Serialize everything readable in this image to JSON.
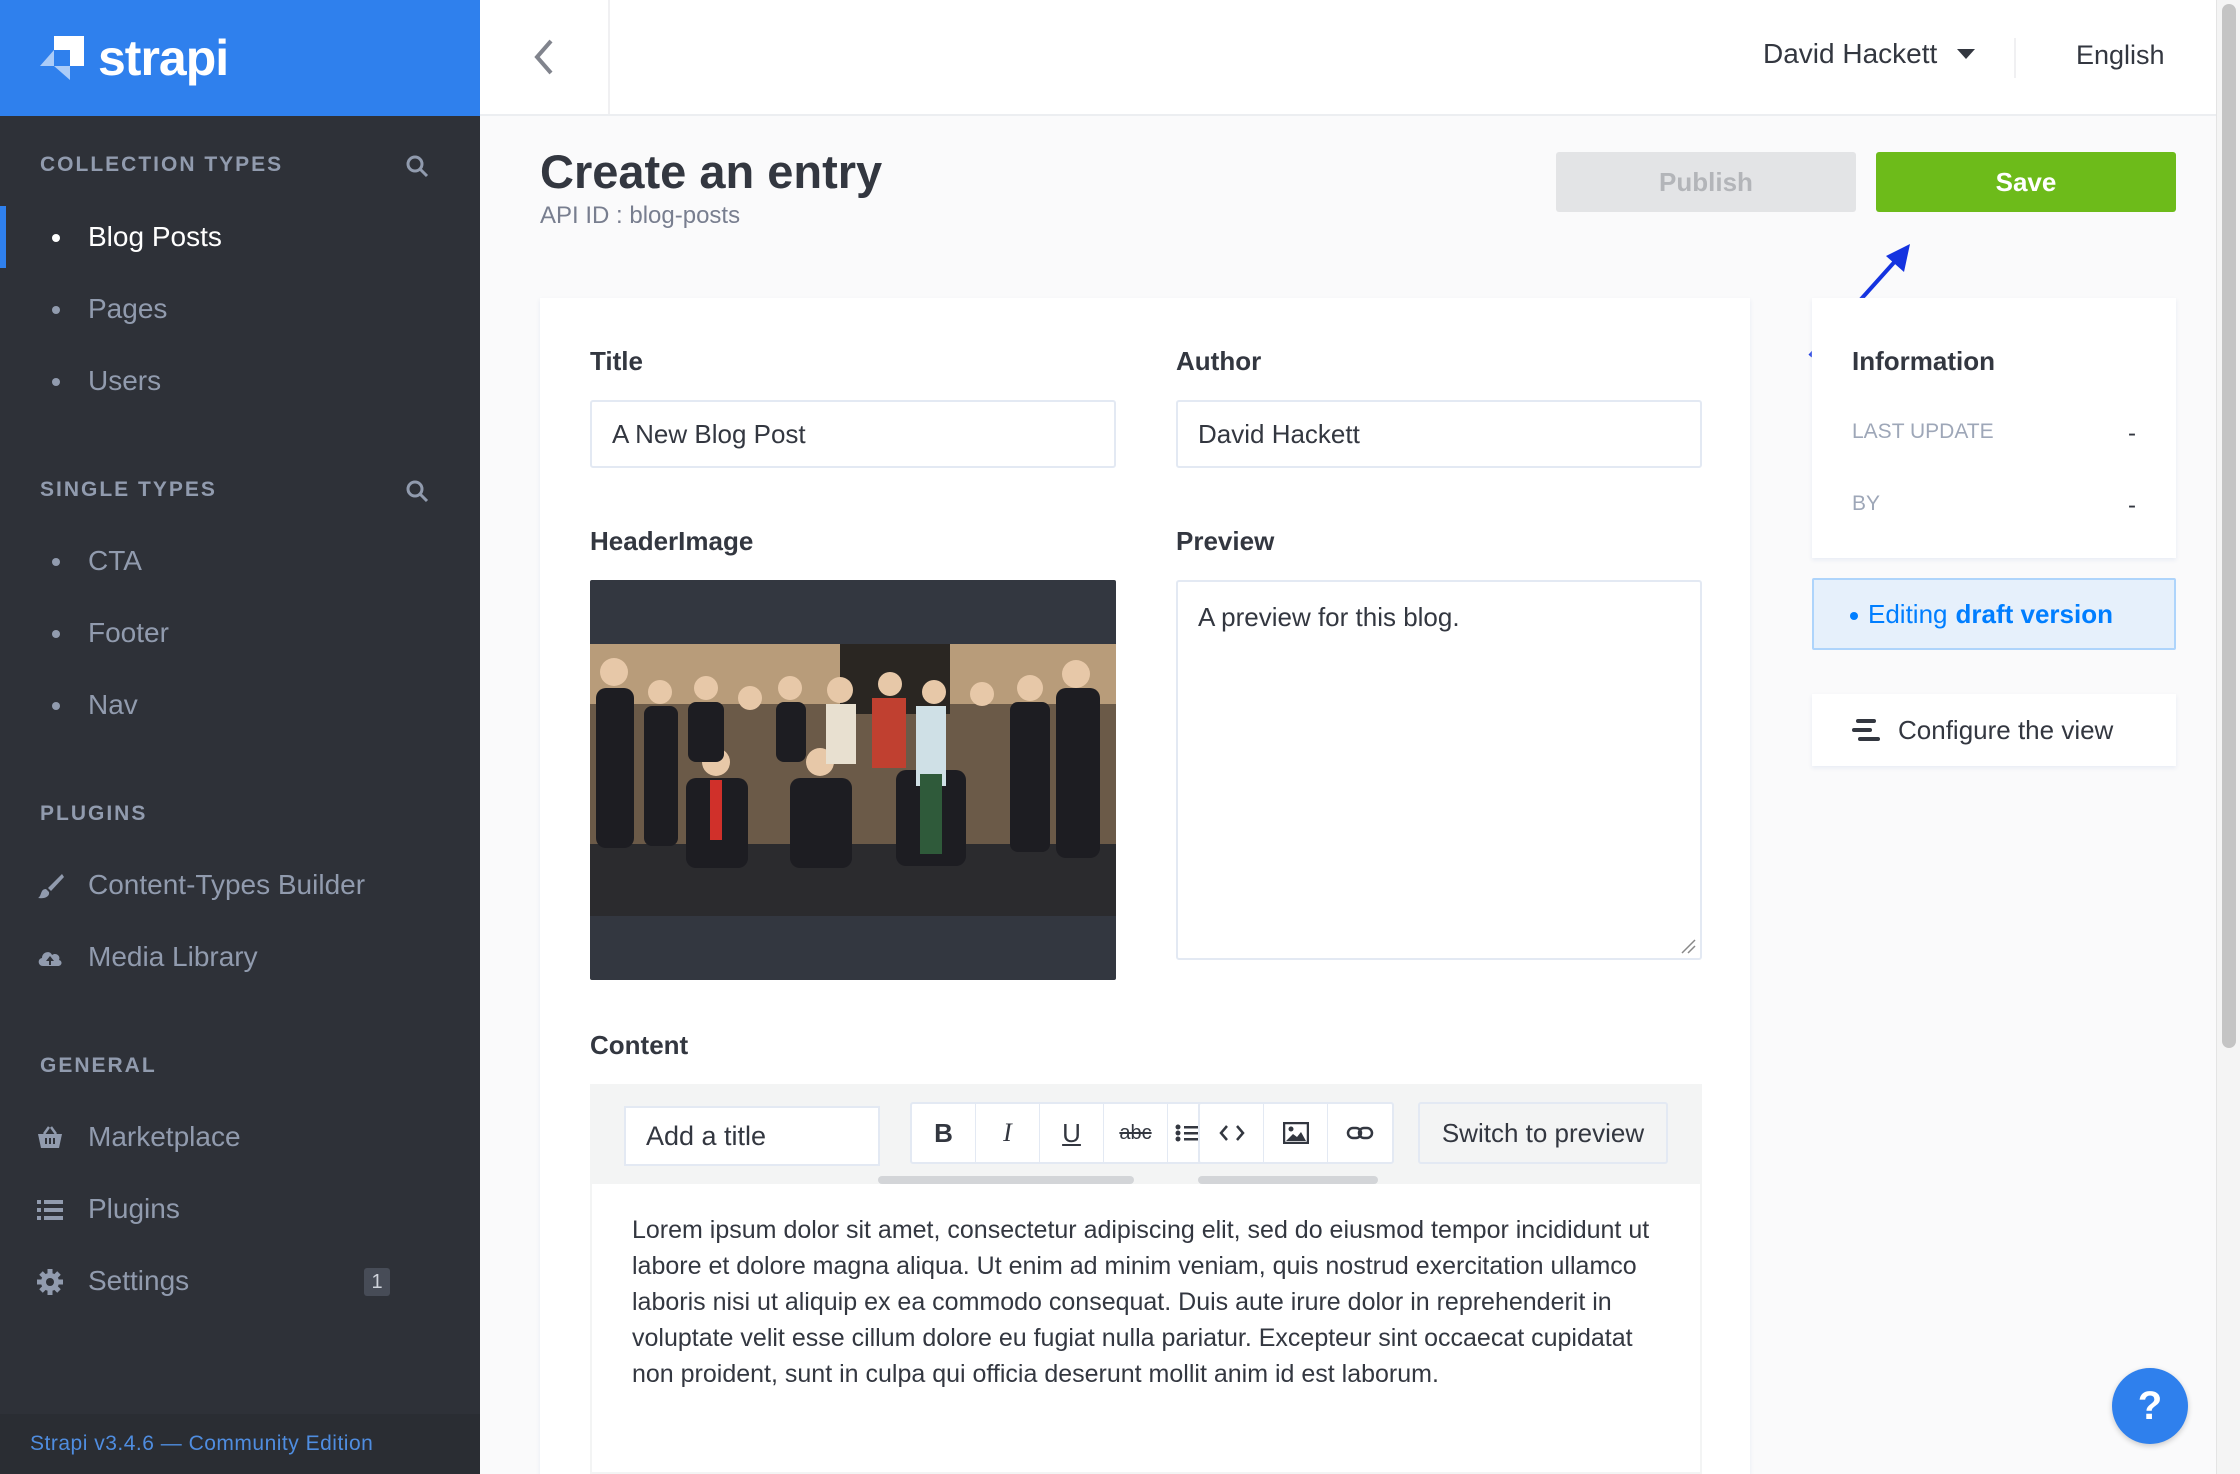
{
  "brand": {
    "name": "strapi",
    "color": "#2f80ed"
  },
  "sidebar": {
    "collection_types": {
      "title": "COLLECTION TYPES",
      "items": [
        {
          "label": "Blog Posts",
          "active": true
        },
        {
          "label": "Pages"
        },
        {
          "label": "Users"
        }
      ]
    },
    "single_types": {
      "title": "SINGLE TYPES",
      "items": [
        {
          "label": "CTA"
        },
        {
          "label": "Footer"
        },
        {
          "label": "Nav"
        }
      ]
    },
    "plugins": {
      "title": "PLUGINS",
      "items": [
        {
          "label": "Content-Types Builder",
          "icon": "paintbrush-icon"
        },
        {
          "label": "Media Library",
          "icon": "cloud-upload-icon"
        }
      ]
    },
    "general": {
      "title": "GENERAL",
      "items": [
        {
          "label": "Marketplace",
          "icon": "basket-icon"
        },
        {
          "label": "Plugins",
          "icon": "list-icon"
        },
        {
          "label": "Settings",
          "icon": "gear-icon",
          "badge": "1"
        }
      ]
    },
    "version": "Strapi v3.4.6 — Community Edition"
  },
  "header": {
    "user": "David Hackett",
    "language": "English"
  },
  "page": {
    "title": "Create an entry",
    "api_id": "API ID : blog-posts",
    "publish_label": "Publish",
    "save_label": "Save"
  },
  "form": {
    "title_label": "Title",
    "title_value": "A New Blog Post",
    "author_label": "Author",
    "author_value": "David Hackett",
    "header_image_label": "HeaderImage",
    "preview_label": "Preview",
    "preview_value": "A preview for this blog.",
    "content_label": "Content",
    "editor": {
      "heading_select": "Add a title",
      "bold": "B",
      "italic": "I",
      "underline": "U",
      "strike": "abc",
      "switch_preview": "Switch to preview",
      "body": "Lorem ipsum dolor sit amet, consectetur adipiscing elit, sed do eiusmod tempor incididunt ut labore et dolore magna aliqua. Ut enim ad minim veniam, quis nostrud exercitation ullamco laboris nisi ut aliquip ex ea commodo consequat. Duis aute irure dolor in reprehenderit in voluptate velit esse cillum dolore eu fugiat nulla pariatur. Excepteur sint occaecat cupidatat non proident, sunt in culpa qui officia deserunt mollit anim id est laborum."
    }
  },
  "info": {
    "title": "Information",
    "last_update_label": "LAST UPDATE",
    "last_update_value": "-",
    "by_label": "BY",
    "by_value": "-",
    "draft_prefix": "Editing",
    "draft_bold": "draft version",
    "configure_label": "Configure the view"
  },
  "help_label": "?",
  "colors": {
    "sidebar_bg": "#2e3138",
    "save_green": "#6dbb1a",
    "accent_blue": "#007eff"
  }
}
